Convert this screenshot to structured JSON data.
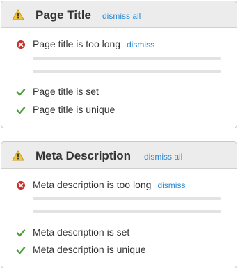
{
  "panels": [
    {
      "title": "Page Title",
      "dismiss_all": "dismiss all",
      "error": {
        "text": "Page title is too long",
        "dismiss": "dismiss",
        "icon": "error-icon"
      },
      "checks": [
        "Page title is set",
        "Page title is unique"
      ]
    },
    {
      "title": "Meta Description",
      "dismiss_all": "dismiss all",
      "error": {
        "text": "Meta description is too long",
        "dismiss": "dismiss",
        "icon": "error-icon"
      },
      "checks": [
        "Meta description is set",
        "Meta description is unique"
      ]
    }
  ],
  "icons": {
    "header": "warning-icon",
    "error": "error-icon",
    "check": "check-icon"
  },
  "colors": {
    "link": "#2b8ad6",
    "error": "#c8302a",
    "check": "#4a9e3a",
    "warning": "#e8b52a",
    "header_bg": "#ececec"
  }
}
